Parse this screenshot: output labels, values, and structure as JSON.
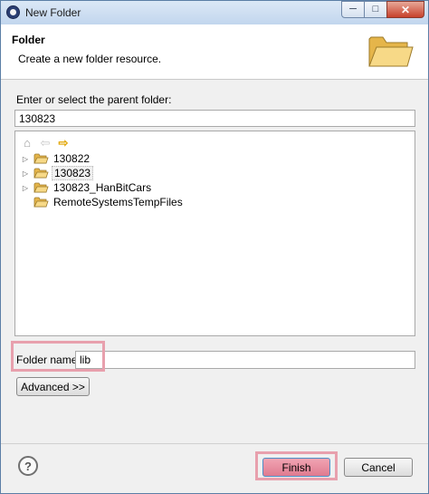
{
  "window": {
    "title": "New Folder",
    "controls": {
      "minimize": "─",
      "maximize": "□",
      "close": "✕"
    }
  },
  "header": {
    "title": "Folder",
    "description": "Create a new folder resource.",
    "icon": "open-folder-icon"
  },
  "parent": {
    "label": "Enter or select the parent folder:",
    "value": "130823"
  },
  "tree": {
    "nav": {
      "home": "⌂",
      "back": "⇦",
      "forward": "⇨"
    },
    "items": [
      {
        "label": "130822",
        "expandable": true,
        "selected": false
      },
      {
        "label": "130823",
        "expandable": true,
        "selected": true
      },
      {
        "label": "130823_HanBitCars",
        "expandable": true,
        "selected": false
      },
      {
        "label": "RemoteSystemsTempFiles",
        "expandable": false,
        "selected": false
      }
    ]
  },
  "folder_name": {
    "label": "Folder name:",
    "value": "lib"
  },
  "buttons": {
    "advanced": "Advanced >>",
    "finish": "Finish",
    "cancel": "Cancel",
    "help": "?"
  },
  "colors": {
    "highlight": "#e8a0ad",
    "window_border": "#5b7ea6",
    "folder": "#f3c85a"
  }
}
